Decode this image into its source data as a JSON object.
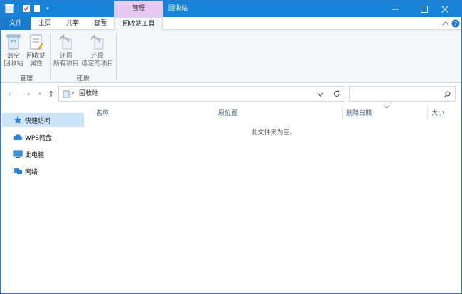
{
  "titlebar": {
    "context_tab": "管理",
    "title": "回收站",
    "minimize": "—",
    "maximize": "☐",
    "close": "✕"
  },
  "ribbon_tabs": {
    "file": "文件",
    "home": "主页",
    "share": "共享",
    "view": "查看",
    "recycle_tools": "回收站工具"
  },
  "ribbon": {
    "empty_bin": [
      "清空",
      "回收站"
    ],
    "properties": [
      "回收站",
      "属性"
    ],
    "restore_all": [
      "还原",
      "所有项目"
    ],
    "restore_selected": [
      "还原",
      "选定的项目"
    ],
    "group_manage": "管理",
    "group_restore": "还原"
  },
  "address": {
    "path": "回收站",
    "search_placeholder": ""
  },
  "nav": {
    "items": [
      {
        "label": "快速访问",
        "icon": "star-icon"
      },
      {
        "label": "WPS网盘",
        "icon": "cloud-icon"
      },
      {
        "label": "此电脑",
        "icon": "computer-icon"
      },
      {
        "label": "网络",
        "icon": "network-icon"
      }
    ]
  },
  "content": {
    "columns": [
      "名称",
      "原位置",
      "删除日期",
      "大小"
    ],
    "empty_message": "此文件夹为空。"
  },
  "colors": {
    "titlebar": "#1683d8",
    "context_tab": "#e5c9f0",
    "file_tab": "#1979ca",
    "selected_nav": "#cce4f7"
  }
}
